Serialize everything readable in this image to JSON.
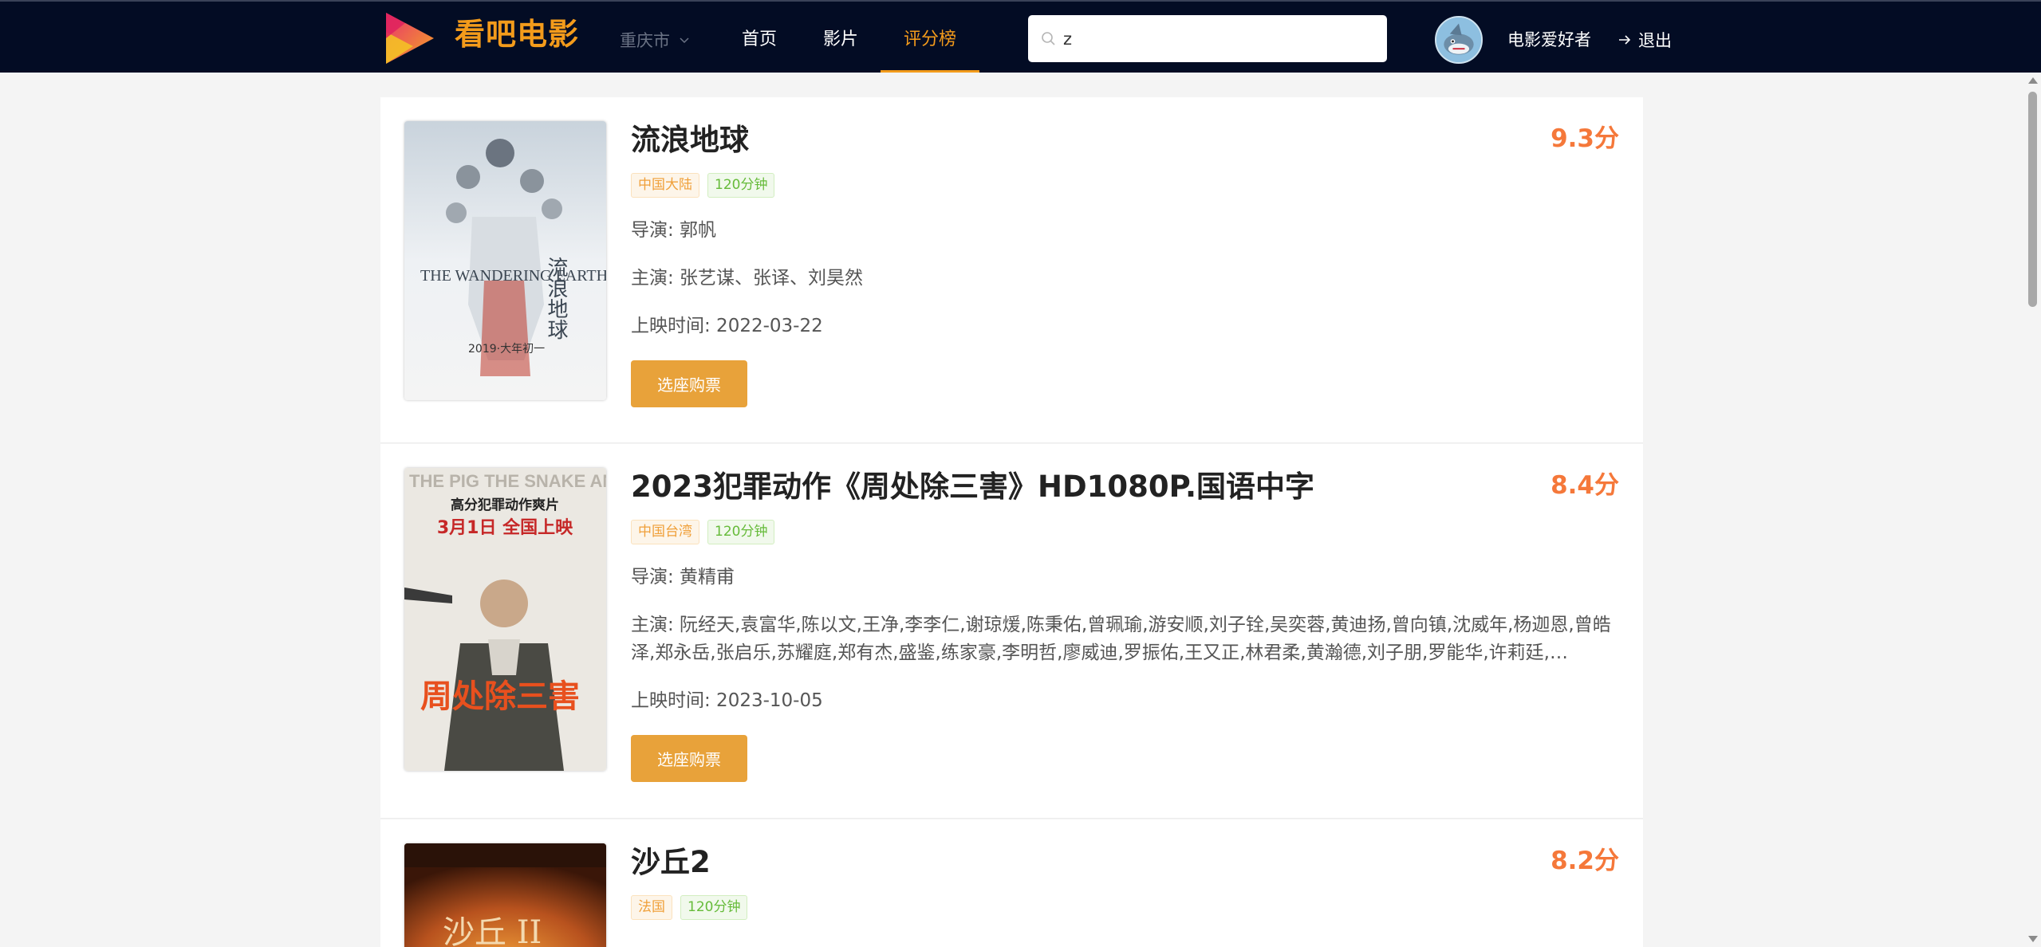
{
  "header": {
    "logo_text": "看吧电影",
    "city": "重庆市",
    "nav": [
      {
        "label": "首页",
        "active": false
      },
      {
        "label": "影片",
        "active": false
      },
      {
        "label": "评分榜",
        "active": true
      }
    ],
    "search": {
      "value": "z",
      "placeholder": ""
    },
    "username": "电影爱好者",
    "logout_label": "退出"
  },
  "movies": [
    {
      "title": "流浪地球",
      "score": "9.3分",
      "region": "中国大陆",
      "duration": "120分钟",
      "director": "导演: 郭帆",
      "cast": "主演: 张艺谋、张译、刘昊然",
      "release": "上映时间: 2022-03-22",
      "button": "选座购票"
    },
    {
      "title": "2023犯罪动作《周处除三害》HD1080P.国语中字",
      "score": "8.4分",
      "region": "中国台湾",
      "duration": "120分钟",
      "director": "导演: 黄精甫",
      "cast": "主演: 阮经天,袁富华,陈以文,王净,李李仁,谢琼煖,陈秉佑,曾珮瑜,游安顺,刘子铨,吴奕蓉,黄迪扬,曾向镇,沈威年,杨迦恩,曾皓泽,郑永岳,张启乐,苏耀庭,郑有杰,盛鉴,练家豪,李明哲,廖威迪,罗振佑,王又正,林君柔,黄瀚德,刘子朋,罗能华,许莉廷,…",
      "release": "上映时间: 2023-10-05",
      "button": "选座购票"
    },
    {
      "title": "沙丘2",
      "score": "8.2分",
      "region": "法国",
      "duration": "120分钟"
    }
  ],
  "posters": [
    {
      "text_a": "THE WANDERING EARTH",
      "text_b": "流浪地球",
      "text_c": "2019·大年初一"
    },
    {
      "text_a": "THE PIG THE SNAKE AND THE PIGEON",
      "text_b": "高分犯罪动作爽片",
      "text_c": "3月1日 全国上映",
      "text_d": "周处除三害"
    },
    {
      "text_a": "沙丘 II"
    }
  ],
  "colors": {
    "header_bg": "#030c24",
    "accent": "#f39b1b",
    "score": "#f5783a",
    "button": "#e8a23a"
  }
}
